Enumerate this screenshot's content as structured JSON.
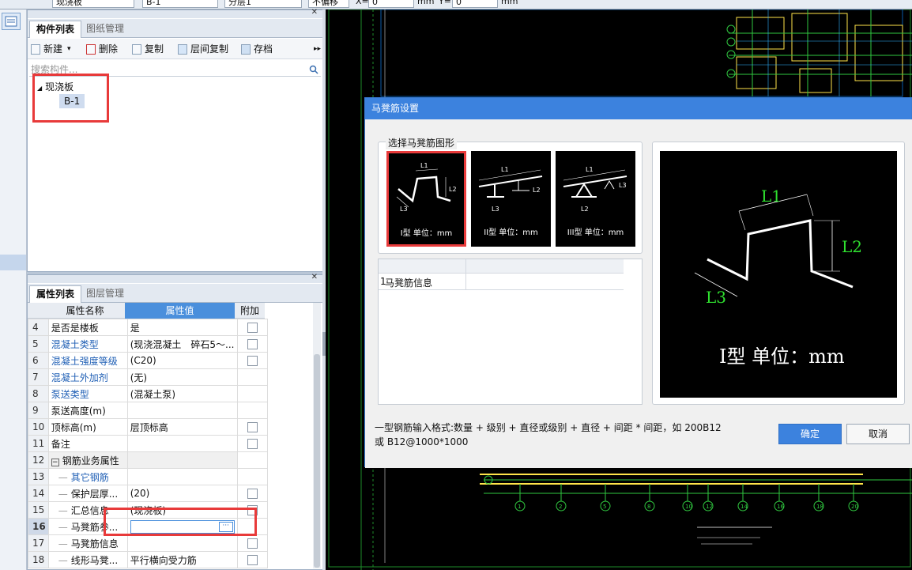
{
  "toolbar": {
    "type_value": "现浇板",
    "name_value": "B-1",
    "floor_value": "分层1",
    "offset_mode": "不偏移",
    "x_label": "X=",
    "x_value": "0",
    "unit1": "mm",
    "y_label": "Y=",
    "y_value": "0",
    "unit2": "mm"
  },
  "component_panel": {
    "tabs": [
      "构件列表",
      "图纸管理"
    ],
    "tools": [
      "新建",
      "删除",
      "复制",
      "层间复制",
      "存档"
    ],
    "search_placeholder": "搜索构件...",
    "tree_root": "现浇板",
    "tree_child": "B-1"
  },
  "property_panel": {
    "tabs": [
      "属性列表",
      "图层管理"
    ],
    "headers": [
      "属性名称",
      "属性值",
      "附加"
    ],
    "rows": [
      {
        "num": "4",
        "name": "是否是楼板",
        "value": "是",
        "cb": true,
        "blue": false
      },
      {
        "num": "5",
        "name": "混凝土类型",
        "value": "(现浇混凝土　碎石5～...",
        "cb": true,
        "blue": true
      },
      {
        "num": "6",
        "name": "混凝土强度等级",
        "value": "(C20)",
        "cb": true,
        "blue": true
      },
      {
        "num": "7",
        "name": "混凝土外加剂",
        "value": "(无)",
        "cb": false,
        "blue": true
      },
      {
        "num": "8",
        "name": "泵送类型",
        "value": "(混凝土泵)",
        "cb": false,
        "blue": true
      },
      {
        "num": "9",
        "name": "泵送高度(m)",
        "value": "",
        "cb": false,
        "blue": false
      },
      {
        "num": "10",
        "name": "顶标高(m)",
        "value": "层顶标高",
        "cb": true,
        "blue": false
      },
      {
        "num": "11",
        "name": "备注",
        "value": "",
        "cb": true,
        "blue": false
      },
      {
        "num": "12",
        "name": "钢筋业务属性",
        "value": "",
        "cb": false,
        "blue": false
      },
      {
        "num": "13",
        "name": "其它钢筋",
        "value": "",
        "cb": false,
        "blue": true
      },
      {
        "num": "14",
        "name": "保护层厚...",
        "value": "(20)",
        "cb": true,
        "blue": false
      },
      {
        "num": "15",
        "name": "汇总信息",
        "value": "(现浇板)",
        "cb": true,
        "blue": false
      },
      {
        "num": "16",
        "name": "马凳筋参...",
        "value": "",
        "cb": false,
        "blue": false
      },
      {
        "num": "17",
        "name": "马凳筋信息",
        "value": "",
        "cb": true,
        "blue": false
      },
      {
        "num": "18",
        "name": "线形马凳...",
        "value": "平行横向受力筋",
        "cb": true,
        "blue": false
      }
    ]
  },
  "dialog": {
    "title": "马凳筋设置",
    "group_label": "选择马凳筋图形",
    "shapes": [
      "I型 单位：mm",
      "II型 单位：mm",
      "III型 单位：mm"
    ],
    "table_row_num": "1",
    "table_row_label": "马凳筋信息",
    "preview": {
      "l1": "L1",
      "l2": "L2",
      "l3": "L3",
      "caption": "I型 单位：mm"
    },
    "hint_line1": "一型钢筋输入格式:数量 + 级别 + 直径或级别 + 直径 + 间距 * 间距，如 200B12",
    "hint_line2": "或 B12@1000*1000",
    "ok": "确定",
    "cancel": "取消"
  },
  "cad": {
    "axis_labels": [
      "1",
      "2",
      "5",
      "8",
      "10",
      "12",
      "14",
      "16",
      "18",
      "20"
    ]
  }
}
